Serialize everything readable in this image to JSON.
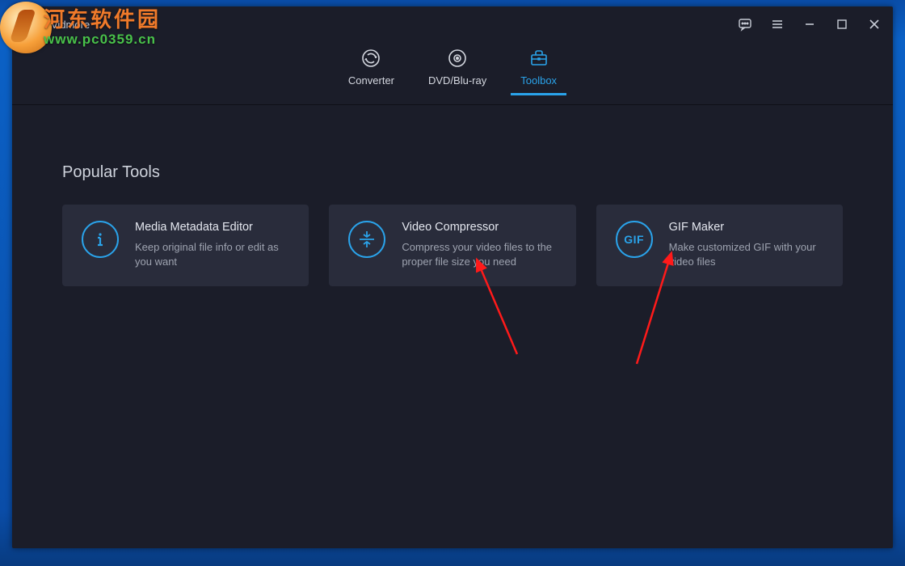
{
  "app": {
    "name": "Vidmore"
  },
  "tabs": {
    "converter": "Converter",
    "dvd": "DVD/Blu-ray",
    "toolbox": "Toolbox"
  },
  "section": {
    "title": "Popular Tools"
  },
  "cards": {
    "meta": {
      "title": "Media Metadata Editor",
      "desc": "Keep original file info or edit as you want"
    },
    "compress": {
      "title": "Video Compressor",
      "desc": "Compress your video files to the proper file size you need"
    },
    "gif": {
      "title": "GIF Maker",
      "desc": "Make customized GIF with your video files",
      "badge": "GIF"
    }
  },
  "watermark": {
    "line1": "河东软件园",
    "line2": "www.pc0359.cn"
  }
}
